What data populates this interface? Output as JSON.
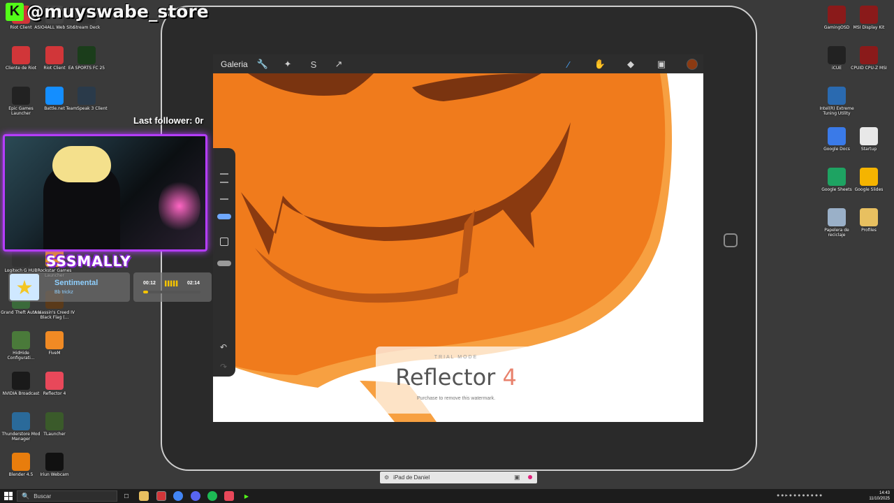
{
  "overlay": {
    "kick_logo": "K",
    "handle": "@muyswabe_store",
    "last_follower": "Last follower: 0r",
    "streamer_name": "SSSMALLY",
    "music": {
      "title": "Sentimental",
      "artist": "Bb trickz",
      "elapsed": "00:12",
      "total": "02:14",
      "progress": 0.09
    }
  },
  "desktop_left": [
    {
      "label": "Riot Client",
      "icon": "riot-client-icon",
      "color": "#d13639"
    },
    {
      "label": "ASIO4ALL Web Site",
      "icon": "asio-icon",
      "color": "#444444"
    },
    {
      "label": "Stream Deck",
      "icon": "stream-deck-icon",
      "color": "#333333"
    },
    {
      "label": "Cliente de Riot",
      "icon": "riot-icon",
      "color": "#d13639"
    },
    {
      "label": "Riot Client",
      "icon": "riot-icon",
      "color": "#d13639"
    },
    {
      "label": "EA SPORTS FC 25",
      "icon": "ea-fc-icon",
      "color": "#1b3d1b"
    },
    {
      "label": "Epic Games Launcher",
      "icon": "epic-icon",
      "color": "#222222"
    },
    {
      "label": "Battle.net",
      "icon": "battlenet-icon",
      "color": "#148eff"
    },
    {
      "label": "TeamSpeak 3 Client",
      "icon": "teamspeak-icon",
      "color": "#2a3a4a"
    },
    {
      "label": "Logitech G HUB",
      "icon": "logitech-icon",
      "color": "#333333"
    },
    {
      "label": "Rockstar Games Launcher",
      "icon": "rockstar-icon",
      "color": "#e8a000"
    },
    {
      "label": "Grand Theft Auto V",
      "icon": "gta-icon",
      "color": "#3a6a3a"
    },
    {
      "label": "Assassin's Creed IV Black Flag (...",
      "icon": "assassins-creed-icon",
      "color": "#5a3a1a"
    },
    {
      "label": "HidHide Configurati...",
      "icon": "hidhide-icon",
      "color": "#4a7a3a"
    },
    {
      "label": "FiveM",
      "icon": "fivem-icon",
      "color": "#f08a24"
    },
    {
      "label": "NVIDIA Broadcast",
      "icon": "nvidia-icon",
      "color": "#1a1a1a"
    },
    {
      "label": "Reflector 4",
      "icon": "reflector-icon",
      "color": "#e8485a"
    },
    {
      "label": "Thunderstore Mod Manager",
      "icon": "thunderstore-icon",
      "color": "#2a6a9a"
    },
    {
      "label": "TLauncher",
      "icon": "tlauncher-icon",
      "color": "#3a5a2a"
    },
    {
      "label": "Blender 4.5",
      "icon": "blender-icon",
      "color": "#e87d0d"
    },
    {
      "label": "Iriun Webcam",
      "icon": "iriun-icon",
      "color": "#111111"
    }
  ],
  "desktop_right": [
    {
      "label": "GamingOSD",
      "icon": "gamingosd-icon",
      "color": "#8a1a1a"
    },
    {
      "label": "MSI Display Kit",
      "icon": "msi-icon",
      "color": "#8a1a1a"
    },
    {
      "label": "iCUE",
      "icon": "icue-icon",
      "color": "#222222"
    },
    {
      "label": "CPUID CPU-Z MSI",
      "icon": "cpuz-icon",
      "color": "#8a1a1a"
    },
    {
      "label": "Intel(R) Extreme Tuning Utility",
      "icon": "intel-icon",
      "color": "#2a6ab0"
    },
    {
      "label": "Google Docs",
      "icon": "google-docs-icon",
      "color": "#3a7ae8"
    },
    {
      "label": "Startup",
      "icon": "file-icon",
      "color": "#e8e8e8"
    },
    {
      "label": "Google Sheets",
      "icon": "google-sheets-icon",
      "color": "#1ea362"
    },
    {
      "label": "Google Slides",
      "icon": "google-slides-icon",
      "color": "#f5b400"
    },
    {
      "label": "Papelera de reciclaje",
      "icon": "recycle-bin-icon",
      "color": "#9ab0c8"
    },
    {
      "label": "Profiles",
      "icon": "folder-icon",
      "color": "#e8c060"
    }
  ],
  "procreate": {
    "gallery": "Galeria",
    "tools": [
      "wrench-icon",
      "magic-wand-icon",
      "selection-icon",
      "transform-icon",
      "brush-icon",
      "smudge-icon",
      "eraser-icon",
      "layers-icon"
    ],
    "color": "#8b3a12"
  },
  "watermark": {
    "mode": "TRIAL MODE",
    "name": "Reflector",
    "number": "4",
    "sub": "Purchase to remove this watermark."
  },
  "mirror_bar": {
    "device": "iPad de Daniel"
  },
  "taskbar": {
    "search_placeholder": "Buscar",
    "time": "14:43",
    "date": "11/10/2025"
  }
}
